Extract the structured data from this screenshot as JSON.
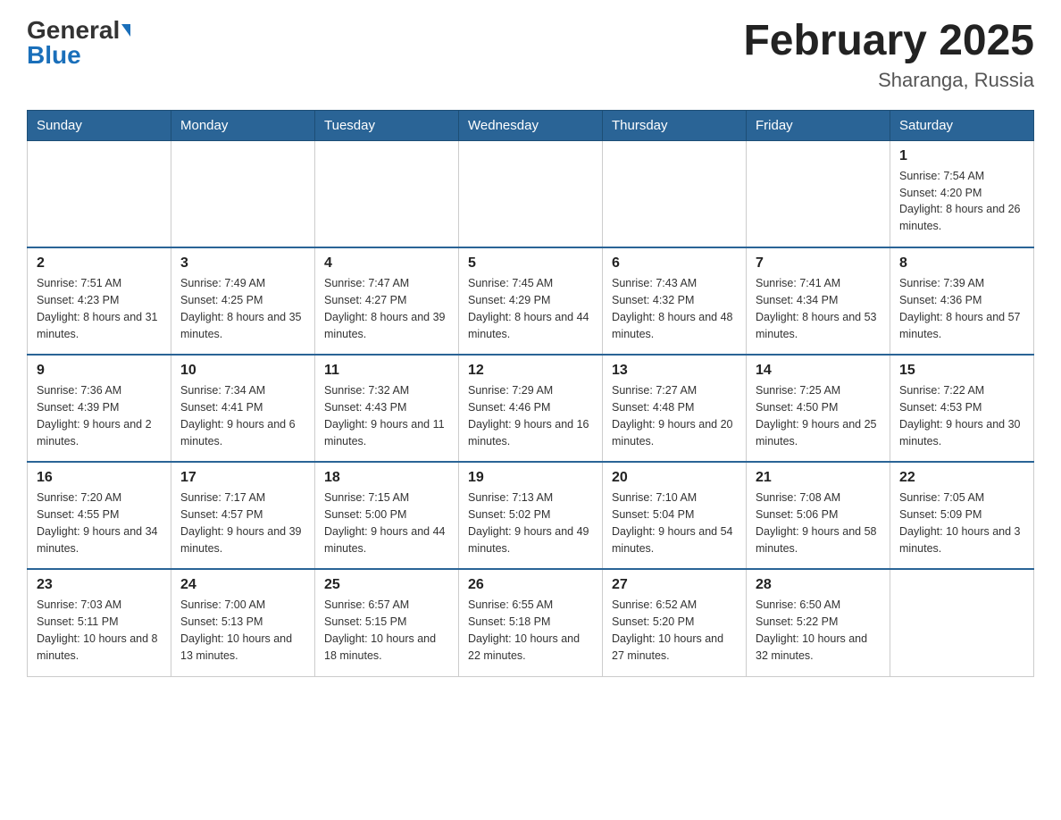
{
  "header": {
    "logo_general": "General",
    "logo_blue": "Blue",
    "month_title": "February 2025",
    "location": "Sharanga, Russia"
  },
  "weekdays": [
    "Sunday",
    "Monday",
    "Tuesday",
    "Wednesday",
    "Thursday",
    "Friday",
    "Saturday"
  ],
  "weeks": [
    [
      {
        "day": "",
        "info": ""
      },
      {
        "day": "",
        "info": ""
      },
      {
        "day": "",
        "info": ""
      },
      {
        "day": "",
        "info": ""
      },
      {
        "day": "",
        "info": ""
      },
      {
        "day": "",
        "info": ""
      },
      {
        "day": "1",
        "info": "Sunrise: 7:54 AM\nSunset: 4:20 PM\nDaylight: 8 hours and 26 minutes."
      }
    ],
    [
      {
        "day": "2",
        "info": "Sunrise: 7:51 AM\nSunset: 4:23 PM\nDaylight: 8 hours and 31 minutes."
      },
      {
        "day": "3",
        "info": "Sunrise: 7:49 AM\nSunset: 4:25 PM\nDaylight: 8 hours and 35 minutes."
      },
      {
        "day": "4",
        "info": "Sunrise: 7:47 AM\nSunset: 4:27 PM\nDaylight: 8 hours and 39 minutes."
      },
      {
        "day": "5",
        "info": "Sunrise: 7:45 AM\nSunset: 4:29 PM\nDaylight: 8 hours and 44 minutes."
      },
      {
        "day": "6",
        "info": "Sunrise: 7:43 AM\nSunset: 4:32 PM\nDaylight: 8 hours and 48 minutes."
      },
      {
        "day": "7",
        "info": "Sunrise: 7:41 AM\nSunset: 4:34 PM\nDaylight: 8 hours and 53 minutes."
      },
      {
        "day": "8",
        "info": "Sunrise: 7:39 AM\nSunset: 4:36 PM\nDaylight: 8 hours and 57 minutes."
      }
    ],
    [
      {
        "day": "9",
        "info": "Sunrise: 7:36 AM\nSunset: 4:39 PM\nDaylight: 9 hours and 2 minutes."
      },
      {
        "day": "10",
        "info": "Sunrise: 7:34 AM\nSunset: 4:41 PM\nDaylight: 9 hours and 6 minutes."
      },
      {
        "day": "11",
        "info": "Sunrise: 7:32 AM\nSunset: 4:43 PM\nDaylight: 9 hours and 11 minutes."
      },
      {
        "day": "12",
        "info": "Sunrise: 7:29 AM\nSunset: 4:46 PM\nDaylight: 9 hours and 16 minutes."
      },
      {
        "day": "13",
        "info": "Sunrise: 7:27 AM\nSunset: 4:48 PM\nDaylight: 9 hours and 20 minutes."
      },
      {
        "day": "14",
        "info": "Sunrise: 7:25 AM\nSunset: 4:50 PM\nDaylight: 9 hours and 25 minutes."
      },
      {
        "day": "15",
        "info": "Sunrise: 7:22 AM\nSunset: 4:53 PM\nDaylight: 9 hours and 30 minutes."
      }
    ],
    [
      {
        "day": "16",
        "info": "Sunrise: 7:20 AM\nSunset: 4:55 PM\nDaylight: 9 hours and 34 minutes."
      },
      {
        "day": "17",
        "info": "Sunrise: 7:17 AM\nSunset: 4:57 PM\nDaylight: 9 hours and 39 minutes."
      },
      {
        "day": "18",
        "info": "Sunrise: 7:15 AM\nSunset: 5:00 PM\nDaylight: 9 hours and 44 minutes."
      },
      {
        "day": "19",
        "info": "Sunrise: 7:13 AM\nSunset: 5:02 PM\nDaylight: 9 hours and 49 minutes."
      },
      {
        "day": "20",
        "info": "Sunrise: 7:10 AM\nSunset: 5:04 PM\nDaylight: 9 hours and 54 minutes."
      },
      {
        "day": "21",
        "info": "Sunrise: 7:08 AM\nSunset: 5:06 PM\nDaylight: 9 hours and 58 minutes."
      },
      {
        "day": "22",
        "info": "Sunrise: 7:05 AM\nSunset: 5:09 PM\nDaylight: 10 hours and 3 minutes."
      }
    ],
    [
      {
        "day": "23",
        "info": "Sunrise: 7:03 AM\nSunset: 5:11 PM\nDaylight: 10 hours and 8 minutes."
      },
      {
        "day": "24",
        "info": "Sunrise: 7:00 AM\nSunset: 5:13 PM\nDaylight: 10 hours and 13 minutes."
      },
      {
        "day": "25",
        "info": "Sunrise: 6:57 AM\nSunset: 5:15 PM\nDaylight: 10 hours and 18 minutes."
      },
      {
        "day": "26",
        "info": "Sunrise: 6:55 AM\nSunset: 5:18 PM\nDaylight: 10 hours and 22 minutes."
      },
      {
        "day": "27",
        "info": "Sunrise: 6:52 AM\nSunset: 5:20 PM\nDaylight: 10 hours and 27 minutes."
      },
      {
        "day": "28",
        "info": "Sunrise: 6:50 AM\nSunset: 5:22 PM\nDaylight: 10 hours and 32 minutes."
      },
      {
        "day": "",
        "info": ""
      }
    ]
  ]
}
